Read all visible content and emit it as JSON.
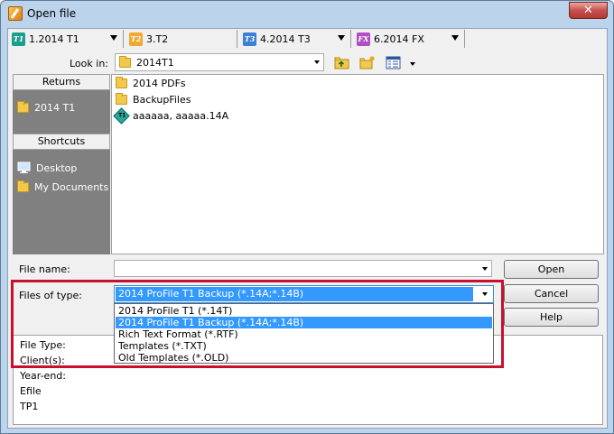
{
  "window": {
    "title": "Open file",
    "close_glyph": "✕"
  },
  "tabs": [
    {
      "icon": "T1",
      "icon_color": "#1a9e8f",
      "label": "1.2014 T1"
    },
    {
      "icon": "T2",
      "icon_color": "#f0a830",
      "label": "3.T2"
    },
    {
      "icon": "T3",
      "icon_color": "#3b7fd6",
      "label": "4.2014 T3"
    },
    {
      "icon": "FX",
      "icon_color": "#b04fc4",
      "label": "6.2014 FX"
    }
  ],
  "lookin": {
    "label": "Look in:",
    "value": "2014T1"
  },
  "places": {
    "returns_header": "Returns",
    "returns_items": [
      "2014 T1"
    ],
    "shortcuts_header": "Shortcuts",
    "shortcut_items": [
      "Desktop",
      "My Documents"
    ]
  },
  "files": [
    {
      "type": "folder",
      "name": "2014 PDFs"
    },
    {
      "type": "folder",
      "name": "BackupFiles"
    },
    {
      "type": "t1",
      "name": "aaaaaa, aaaaa.14A"
    }
  ],
  "t1_file_icon_text": "T1",
  "filename": {
    "label": "File name:",
    "value": ""
  },
  "filetype": {
    "label": "Files of type:",
    "value": "2014 ProFile T1 Backup (*.14A;*.14B)",
    "options": [
      "2014 ProFile T1 (*.14T)",
      "2014 ProFile T1 Backup (*.14A;*.14B)",
      "Rich Text Format (*.RTF)",
      "Templates (*.TXT)",
      "Old Templates (*.OLD)"
    ],
    "selected_index": 1
  },
  "buttons": {
    "open": "Open",
    "cancel": "Cancel",
    "help": "Help"
  },
  "info": [
    "File Type:",
    "Client(s):",
    "Year-end:",
    "Efile",
    "TP1"
  ],
  "colors": {
    "highlight_border": "#c8102e",
    "selection": "#3399ff"
  }
}
